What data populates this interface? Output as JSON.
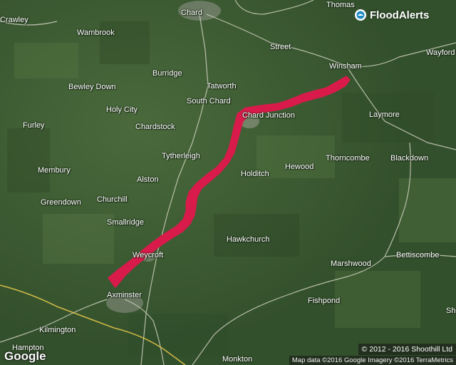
{
  "brand": {
    "name": "FloodAlerts",
    "icon": "floodalerts-logo-icon"
  },
  "places": [
    {
      "id": "chard",
      "label": "Chard"
    },
    {
      "id": "thomas",
      "label": "Thomas"
    },
    {
      "id": "crawley",
      "label": "Crawley"
    },
    {
      "id": "wambrook",
      "label": "Wambrook"
    },
    {
      "id": "street",
      "label": "Street"
    },
    {
      "id": "winsham",
      "label": "Winsham"
    },
    {
      "id": "wayford",
      "label": "Wayford"
    },
    {
      "id": "burridge",
      "label": "Burridge"
    },
    {
      "id": "bewley-down",
      "label": "Bewley Down"
    },
    {
      "id": "tatworth",
      "label": "Tatworth"
    },
    {
      "id": "south-chard",
      "label": "South Chard"
    },
    {
      "id": "holy-city",
      "label": "Holy City"
    },
    {
      "id": "chard-junction",
      "label": "Chard Junction"
    },
    {
      "id": "laymore",
      "label": "Laymore"
    },
    {
      "id": "furley",
      "label": "Furley"
    },
    {
      "id": "chardstock",
      "label": "Chardstock"
    },
    {
      "id": "tytherleigh",
      "label": "Tytherleigh"
    },
    {
      "id": "thorncombe",
      "label": "Thorncombe"
    },
    {
      "id": "blackdown",
      "label": "Blackdown"
    },
    {
      "id": "hewood",
      "label": "Hewood"
    },
    {
      "id": "membury",
      "label": "Membury"
    },
    {
      "id": "holditch",
      "label": "Holditch"
    },
    {
      "id": "alston",
      "label": "Alston"
    },
    {
      "id": "greendown",
      "label": "Greendown"
    },
    {
      "id": "churchill",
      "label": "Churchill"
    },
    {
      "id": "smallridge",
      "label": "Smallridge"
    },
    {
      "id": "hawkchurch",
      "label": "Hawkchurch"
    },
    {
      "id": "weycroft",
      "label": "Weycroft"
    },
    {
      "id": "bettiscombe",
      "label": "Bettiscombe"
    },
    {
      "id": "marshwood",
      "label": "Marshwood"
    },
    {
      "id": "axminster",
      "label": "Axminster"
    },
    {
      "id": "fishpond",
      "label": "Fishpond"
    },
    {
      "id": "kilmington",
      "label": "Kilmington"
    },
    {
      "id": "hampton",
      "label": "Hampton"
    },
    {
      "id": "monkton",
      "label": "Monkton"
    },
    {
      "id": "sh",
      "label": "Sh"
    }
  ],
  "google_logo": "Google",
  "attribution_top": "© 2012 - 2016 Shoothill Ltd",
  "attribution_bottom": "Map data ©2016 Google  Imagery ©2016 TerraMetrics",
  "colors": {
    "flood_area": "#d81b4a",
    "terrain": "#3d5a34",
    "roads": "#d8d8c8",
    "major_road": "#e8c84a"
  }
}
